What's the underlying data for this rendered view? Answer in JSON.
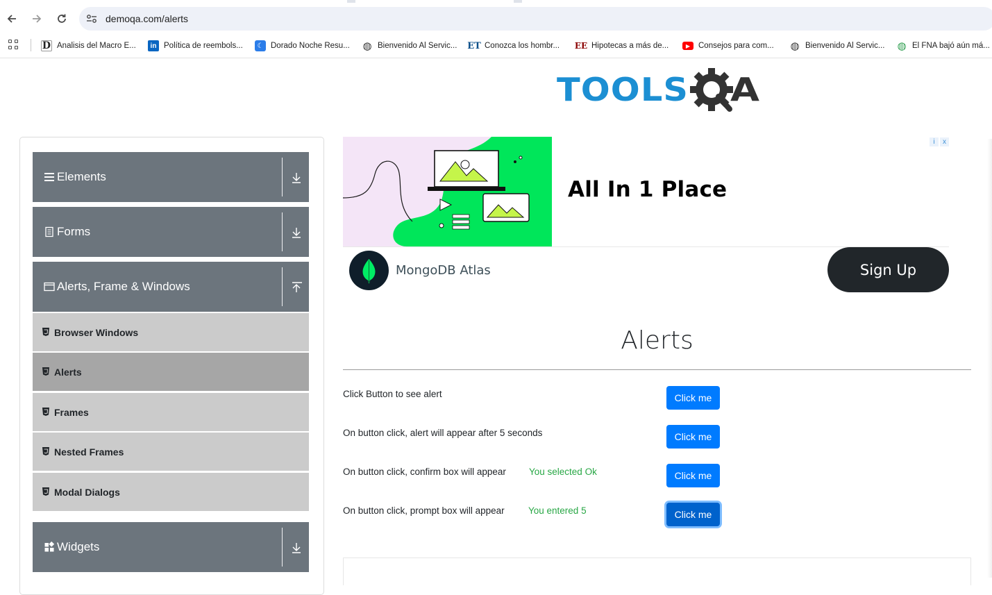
{
  "browser": {
    "url": "demoqa.com/alerts",
    "bookmarks": [
      {
        "label": "Analisis del Macro E...",
        "icon": "d-logo-icon"
      },
      {
        "label": "Política de reembols...",
        "icon": "linkedin-icon"
      },
      {
        "label": "Dorado Noche Resu...",
        "icon": "moon-icon"
      },
      {
        "label": "Bienvenido Al Servic...",
        "icon": "globe-icon"
      },
      {
        "label": "Conozca los hombr...",
        "icon": "et-logo-icon"
      },
      {
        "label": "Hipotecas a más de...",
        "icon": "ee-logo-icon"
      },
      {
        "label": "Consejos para com...",
        "icon": "youtube-icon"
      },
      {
        "label": "Bienvenido Al Servic...",
        "icon": "globe-icon"
      },
      {
        "label": "El FNA bajó aún má...",
        "icon": "globe-green-icon"
      }
    ]
  },
  "logo_text": "TOOLSQA",
  "sidebar": {
    "groups": [
      {
        "label": "Elements",
        "icon": "hamburger-icon",
        "expanded": false
      },
      {
        "label": "Forms",
        "icon": "document-icon",
        "expanded": false
      },
      {
        "label": "Alerts, Frame & Windows",
        "icon": "window-icon",
        "expanded": true
      },
      {
        "label": "Widgets",
        "icon": "widgets-icon",
        "expanded": false
      }
    ],
    "items": [
      {
        "label": "Browser Windows",
        "active": false
      },
      {
        "label": "Alerts",
        "active": true
      },
      {
        "label": "Frames",
        "active": false
      },
      {
        "label": "Nested Frames",
        "active": false
      },
      {
        "label": "Modal Dialogs",
        "active": false
      }
    ]
  },
  "ad": {
    "headline": "All In 1 Place",
    "brand": "MongoDB Atlas",
    "cta": "Sign Up",
    "badge_info": "i",
    "badge_close": "x"
  },
  "main": {
    "title": "Alerts",
    "rows": [
      {
        "label": "Click Button to see alert",
        "result": "",
        "button": "Click me"
      },
      {
        "label": "On button click, alert will appear after 5 seconds",
        "result": "",
        "button": "Click me"
      },
      {
        "label": "On button click, confirm box will appear",
        "result": "You selected Ok",
        "button": "Click me"
      },
      {
        "label": "On button click, prompt box will appear",
        "result": "You entered 5",
        "button": "Click me"
      }
    ]
  },
  "colors": {
    "accent": "#007bff",
    "success": "#28a745",
    "sidebar_group": "#6c757d",
    "sidebar_item": "#cbcbcb",
    "sidebar_item_active": "#a6a6a6",
    "logo_blue": "#1c8fd3",
    "logo_dark": "#333333"
  }
}
